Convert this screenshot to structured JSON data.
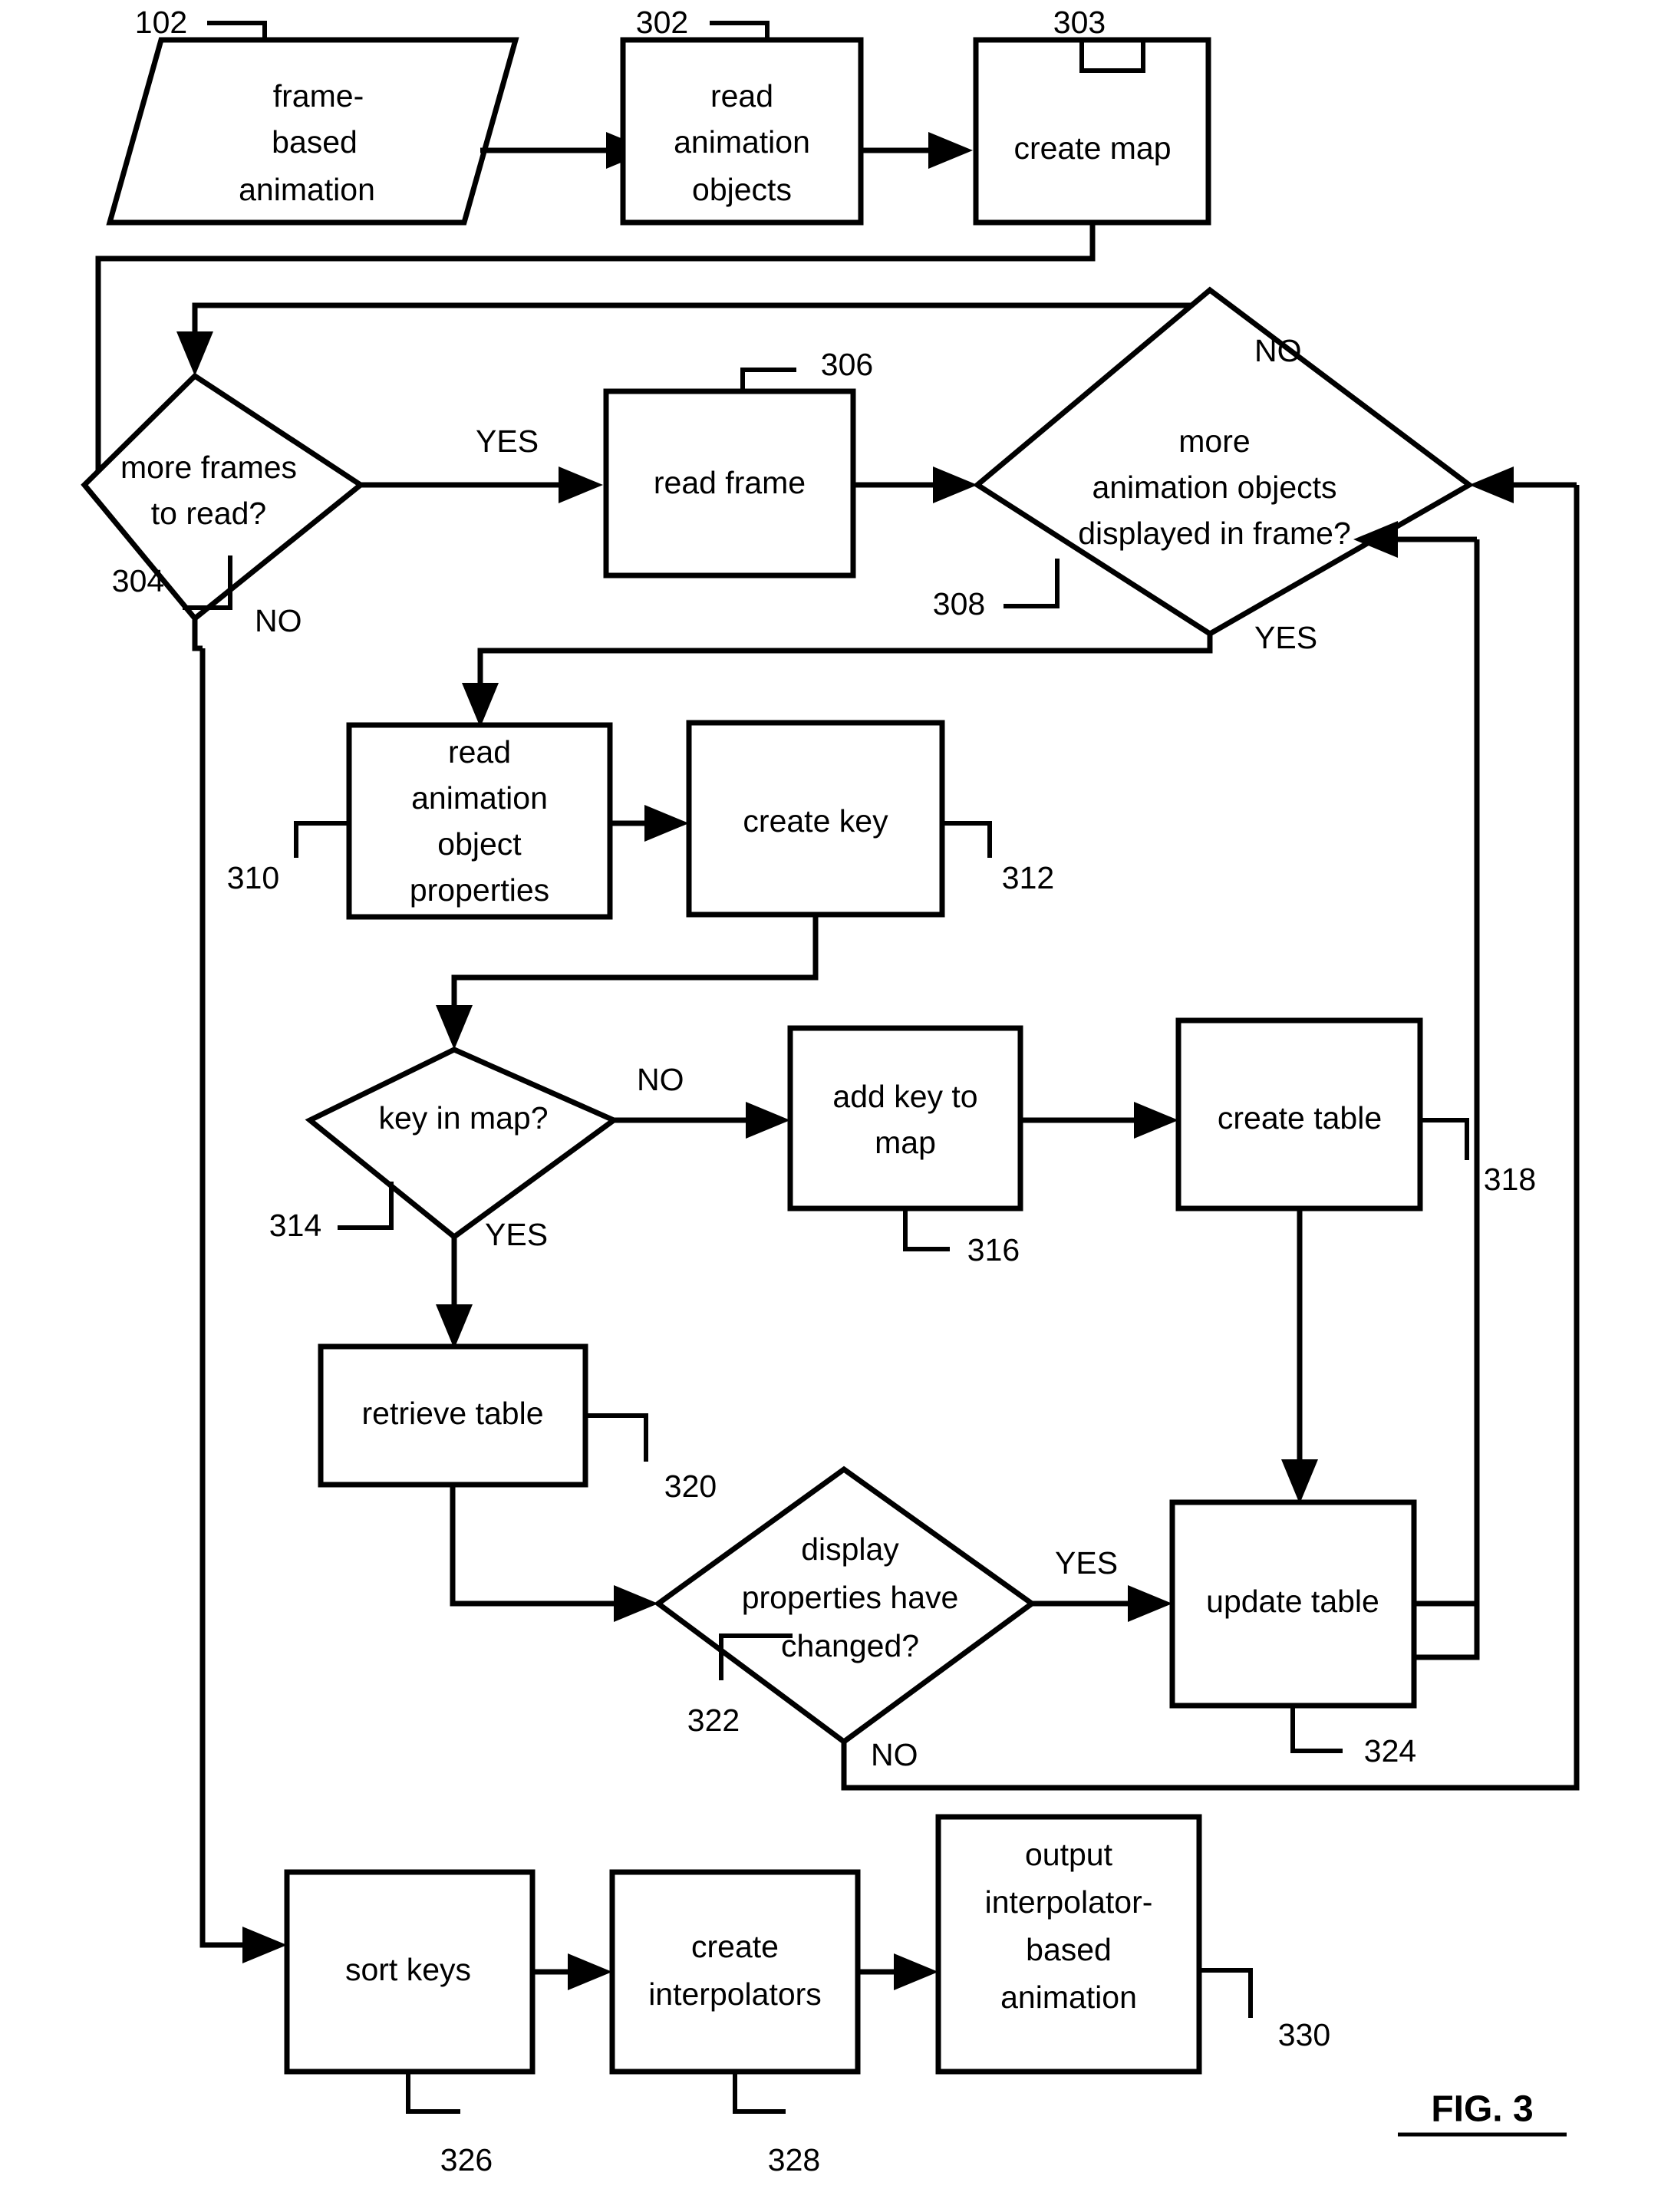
{
  "figure": {
    "label": "FIG. 3",
    "title": "FIG. 3"
  },
  "nodes": {
    "frame_based_animation": {
      "ref": "102",
      "shape": "parallelogram",
      "lines": [
        "frame-",
        "based",
        "animation"
      ]
    },
    "read_animation_objects": {
      "ref": "302",
      "shape": "process",
      "lines": [
        "read",
        "animation",
        "objects"
      ]
    },
    "create_map": {
      "ref": "303",
      "shape": "process",
      "lines": [
        "create map"
      ]
    },
    "more_frames_to_read": {
      "ref": "304",
      "shape": "decision",
      "lines": [
        "more frames",
        "to read?"
      ],
      "yes": "YES",
      "no": "NO"
    },
    "read_frame": {
      "ref": "306",
      "shape": "process",
      "lines": [
        "read frame"
      ]
    },
    "more_animation_objects": {
      "ref": "308",
      "shape": "decision",
      "lines": [
        "more",
        "animation objects",
        "displayed in frame?"
      ],
      "yes": "YES",
      "no": "NO"
    },
    "read_animation_object_properties": {
      "ref": "310",
      "shape": "process",
      "lines": [
        "read",
        "animation",
        "object",
        "properties"
      ]
    },
    "create_key": {
      "ref": "312",
      "shape": "process",
      "lines": [
        "create key"
      ]
    },
    "key_in_map": {
      "ref": "314",
      "shape": "decision",
      "lines": [
        "key in map?"
      ],
      "yes": "YES",
      "no": "NO"
    },
    "add_key_to_map": {
      "ref": "316",
      "shape": "process",
      "lines": [
        "add key to",
        "map"
      ]
    },
    "create_table": {
      "ref": "318",
      "shape": "process",
      "lines": [
        "create table"
      ]
    },
    "retrieve_table": {
      "ref": "320",
      "shape": "process",
      "lines": [
        "retrieve table"
      ]
    },
    "display_properties_changed": {
      "ref": "322",
      "shape": "decision",
      "lines": [
        "display",
        "properties have",
        "changed?"
      ],
      "yes": "YES",
      "no": "NO"
    },
    "update_table": {
      "ref": "324",
      "shape": "process",
      "lines": [
        "update table"
      ]
    },
    "sort_keys": {
      "ref": "326",
      "shape": "process",
      "lines": [
        "sort keys"
      ]
    },
    "create_interpolators": {
      "ref": "328",
      "shape": "process",
      "lines": [
        "create",
        "interpolators"
      ]
    },
    "output_interpolator_based_animation": {
      "ref": "330",
      "shape": "process",
      "lines": [
        "output",
        "interpolator-",
        "based",
        "animation"
      ]
    }
  },
  "text_items": [
    {
      "id": "t-ref-102",
      "value": "102"
    },
    {
      "id": "t-ref-302",
      "value": "302"
    },
    {
      "id": "t-ref-303",
      "value": "303"
    },
    {
      "id": "t-ref-304",
      "value": "304"
    },
    {
      "id": "t-ref-306",
      "value": "306"
    },
    {
      "id": "t-ref-308",
      "value": "308"
    },
    {
      "id": "t-ref-310",
      "value": "310"
    },
    {
      "id": "t-ref-312",
      "value": "312"
    },
    {
      "id": "t-ref-314",
      "value": "314"
    },
    {
      "id": "t-ref-316",
      "value": "316"
    },
    {
      "id": "t-ref-318",
      "value": "318"
    },
    {
      "id": "t-ref-320",
      "value": "320"
    },
    {
      "id": "t-ref-322",
      "value": "322"
    },
    {
      "id": "t-ref-324",
      "value": "324"
    },
    {
      "id": "t-ref-326",
      "value": "326"
    },
    {
      "id": "t-ref-328",
      "value": "328"
    },
    {
      "id": "t-ref-330",
      "value": "330"
    }
  ],
  "branch_labels": {
    "frames_yes": "YES",
    "frames_no": "NO",
    "objects_no": "NO",
    "objects_yes": "YES",
    "key_no": "NO",
    "key_yes": "YES",
    "changed_yes": "YES",
    "changed_no": "NO"
  },
  "colors": {
    "ink": "#000000",
    "paper": "#ffffff"
  }
}
